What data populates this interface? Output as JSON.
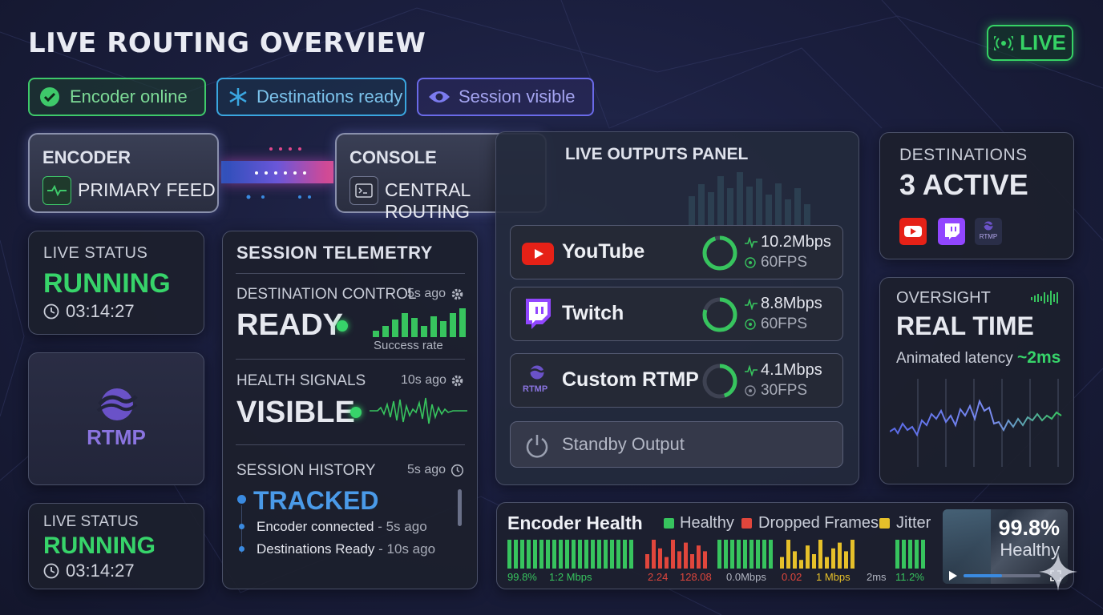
{
  "header": {
    "title": "LIVE ROUTING OVERVIEW",
    "live_badge": "LIVE"
  },
  "chips": [
    {
      "label": "Encoder online",
      "icon": "check-circle-icon",
      "color": "#3ec96a"
    },
    {
      "label": "Destinations ready",
      "icon": "asterisk-icon",
      "color": "#3aa6e0"
    },
    {
      "label": "Session visible",
      "icon": "eye-icon",
      "color": "#6a6ae8"
    }
  ],
  "encoder": {
    "heading": "ENCODER",
    "label": "PRIMARY FEED"
  },
  "console": {
    "heading": "CONSOLE",
    "label": "CENTRAL ROUTING"
  },
  "live_status_top": {
    "heading": "LIVE STATUS",
    "state": "RUNNING",
    "time": "03:14:27"
  },
  "live_status_bottom": {
    "heading": "LIVE STATUS",
    "state": "RUNNING",
    "time": "03:14:27"
  },
  "rtmp_logo": {
    "text": "RTMP"
  },
  "telemetry": {
    "heading": "SESSION TELEMETRY",
    "destination_control": {
      "label": "DESTINATION CONTROL",
      "ago": "5s ago",
      "value": "READY",
      "caption": "Success rate"
    },
    "health_signals": {
      "label": "HEALTH SIGNALS",
      "ago": "10s ago",
      "value": "VISIBLE"
    },
    "session_history": {
      "label": "SESSION HISTORY",
      "ago": "5s ago",
      "value": "TRACKED",
      "events": [
        {
          "name": "Encoder connected",
          "time": " - 5s ago"
        },
        {
          "name": "Destinations Ready",
          "time": " - 10s ago"
        }
      ]
    }
  },
  "outputs": {
    "heading": "LIVE OUTPUTS PANEL",
    "rows": [
      {
        "name": "YouTube",
        "bitrate": "10.2Mbps",
        "fps": "60FPS",
        "level": 0.95,
        "icon": "youtube-icon"
      },
      {
        "name": "Twitch",
        "bitrate": "8.8Mbps",
        "fps": "60FPS",
        "level": 0.8,
        "icon": "twitch-icon"
      },
      {
        "name": "Custom RTMP",
        "bitrate": "4.1Mbps",
        "fps": "30FPS",
        "level": 0.45,
        "icon": "rtmp-icon",
        "icon_text": "RTMP"
      }
    ],
    "standby": "Standby Output"
  },
  "destinations": {
    "heading": "DESTINATIONS",
    "count": "3 ACTIVE",
    "mini_rtmp": "RTMP"
  },
  "oversight": {
    "heading": "OVERSIGHT",
    "value": "REAL TIME",
    "latency_label": "Animated latency",
    "latency_value": "~2ms"
  },
  "encoder_health": {
    "heading": "Encoder Health",
    "legend": [
      {
        "label": "Healthy",
        "color": "#37c45e"
      },
      {
        "label": "Dropped Frames",
        "color": "#e0463c"
      },
      {
        "label": "Jitter",
        "color": "#e6c02a"
      }
    ],
    "stats": [
      "99.8%",
      "1:2 Mbps",
      "2.24",
      "128.08",
      "0.0Mbps",
      "0.02",
      "1 Mbps",
      "2ms",
      "11.2%"
    ],
    "preview": {
      "percent": "99.8%",
      "status": "Healthy",
      "progress": 0.5
    }
  }
}
